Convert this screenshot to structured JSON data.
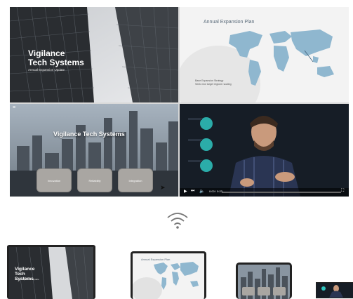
{
  "slides": {
    "cover": {
      "title": "Vigilance Tech Systems",
      "subtitle": "Annual Expansion Update"
    },
    "map": {
      "title": "Annual Expansion Plan",
      "note_line1": "Base Expansion Strategy",
      "note_line2": "Seek new target regions' scaling"
    },
    "city": {
      "title": "Vigilance Tech Systems",
      "tiles": [
        "Innovation",
        "Reliability",
        "Integration"
      ]
    },
    "video": {
      "time": "0:00 / 0:23"
    }
  },
  "devices": {
    "laptop": {
      "title": "Vigilance Tech Systems",
      "subtitle": "Annual Expansion Update"
    },
    "tablet": {
      "title": "Annual Expansion Plan"
    }
  },
  "colors": {
    "map_land": "#8fb7cf",
    "tile": "#a9a6a2"
  },
  "icons": [
    "wifi-icon",
    "play-icon",
    "skip-icon",
    "volume-icon",
    "menu-icon",
    "cursor-icon",
    "fullscreen-icon"
  ]
}
